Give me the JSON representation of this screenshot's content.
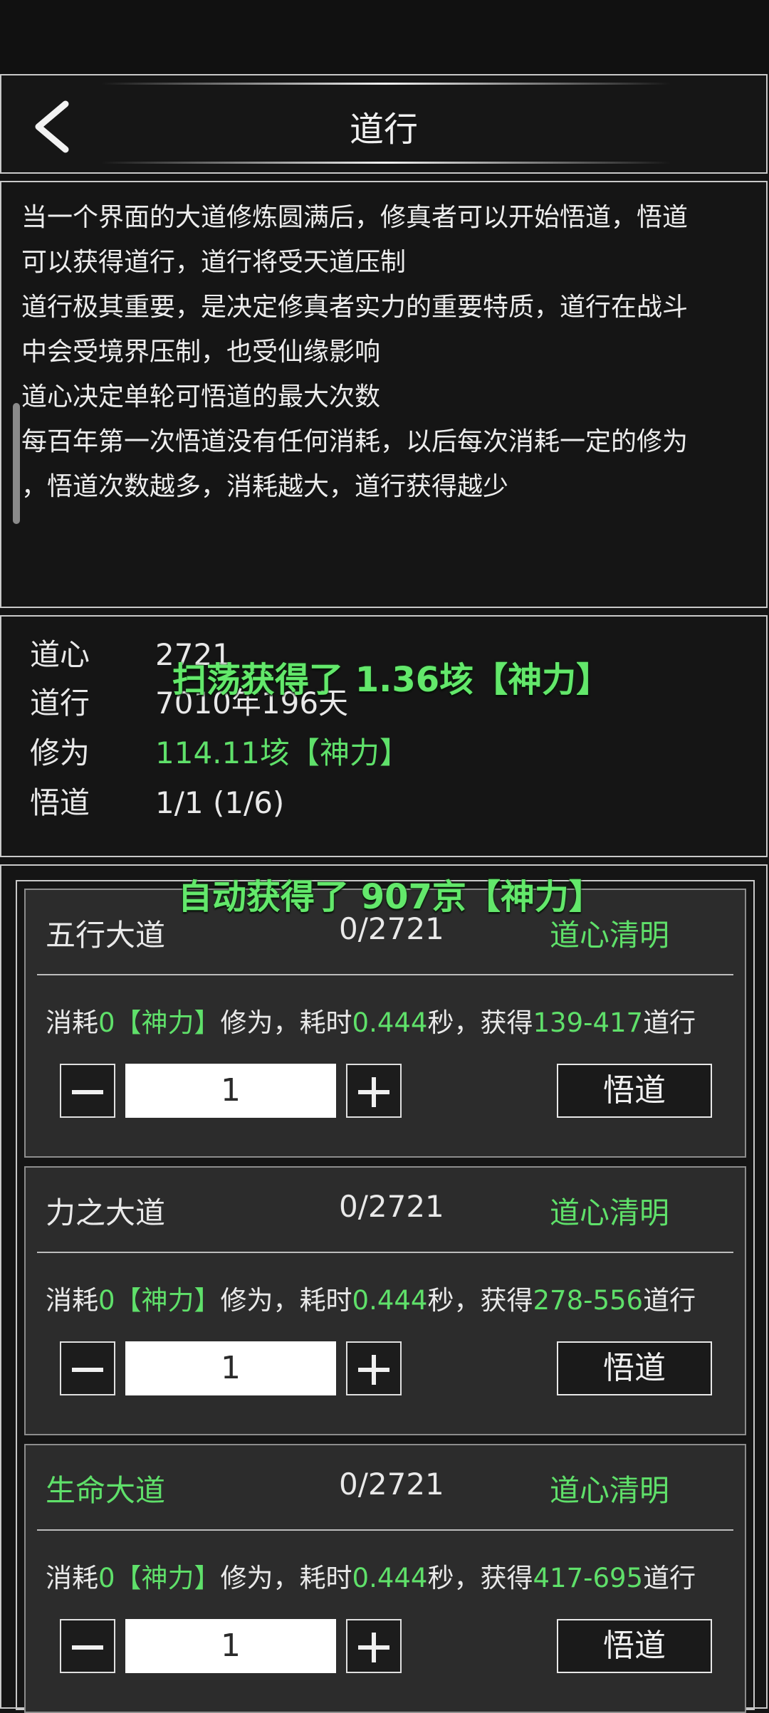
{
  "header": {
    "title": "道行",
    "back_icon": "chevron-left-icon"
  },
  "description": {
    "lines": [
      "当一个界面的大道修炼圆满后，修真者可以开始悟道，悟道",
      "可以获得道行，道行将受天道压制",
      "道行极其重要，是决定修真者实力的重要特质，道行在战斗",
      "中会受境界压制，也受仙缘影响",
      "道心决定单轮可悟道的最大次数",
      "每百年第一次悟道没有任何消耗，以后每次消耗一定的修为",
      "，悟道次数越多，消耗越大，道行获得越少"
    ]
  },
  "stats": {
    "daoxin": {
      "label": "道心",
      "value": "2721"
    },
    "daoxing": {
      "label": "道行",
      "value": "7010年196天"
    },
    "xiuwei": {
      "label": "修为",
      "value": "114.11垓【神力】"
    },
    "wudao": {
      "label": "悟道",
      "value": "1/1 (1/6)"
    }
  },
  "toasts": {
    "sweep": "扫荡获得了 1.36垓【神力】",
    "auto": "自动获得了 907京【神力】"
  },
  "cards": [
    {
      "name": "五行大道",
      "count": "0/2721",
      "state": "道心清明",
      "cost_prefix": "消耗",
      "cost_value": "0【神力】",
      "cost_mid": "修为，耗时",
      "time_value": "0.444",
      "time_unit": "秒，获得",
      "gain_value": "139-417",
      "gain_unit": "道行",
      "quantity": "1",
      "button_label": "悟道",
      "name_color": "#e9e9e9"
    },
    {
      "name": "力之大道",
      "count": "0/2721",
      "state": "道心清明",
      "cost_prefix": "消耗",
      "cost_value": "0【神力】",
      "cost_mid": "修为，耗时",
      "time_value": "0.444",
      "time_unit": "秒，获得",
      "gain_value": "278-556",
      "gain_unit": "道行",
      "quantity": "1",
      "button_label": "悟道",
      "name_color": "#e9e9e9"
    },
    {
      "name": "生命大道",
      "count": "0/2721",
      "state": "道心清明",
      "cost_prefix": "消耗",
      "cost_value": "0【神力】",
      "cost_mid": "修为，耗时",
      "time_value": "0.444",
      "time_unit": "秒，获得",
      "gain_value": "417-695",
      "gain_unit": "道行",
      "quantity": "1",
      "button_label": "悟道",
      "name_color": "#5fe06a"
    }
  ],
  "colors": {
    "accent_green": "#5fe06a",
    "background": "#141414",
    "card": "#2c2c2c"
  }
}
